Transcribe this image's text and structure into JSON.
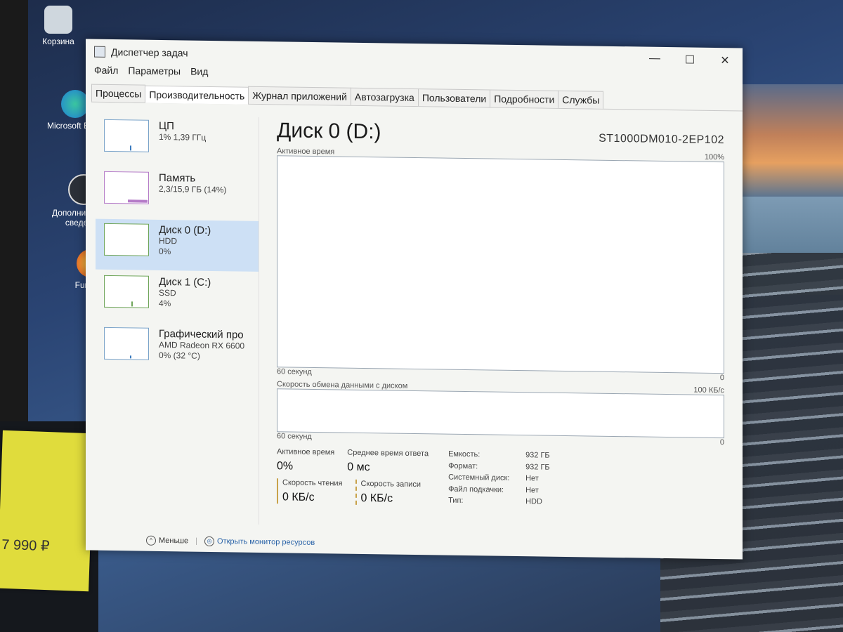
{
  "desktop": {
    "icons": [
      {
        "label": "Корзина",
        "icon": "recycle-bin-icon"
      },
      {
        "label": "Microsoft Edge",
        "icon": "edge-icon"
      },
      {
        "label": "Дополнительные сведения",
        "icon": "info-icon"
      },
      {
        "label": "FurMark",
        "icon": "furmark-icon"
      }
    ],
    "price": "7 990 ₽"
  },
  "window": {
    "title": "Диспетчер задач",
    "controls": {
      "minimize": "—",
      "maximize": "☐",
      "close": "✕"
    }
  },
  "menu": [
    "Файл",
    "Параметры",
    "Вид"
  ],
  "tabs": [
    {
      "label": "Процессы",
      "active": false
    },
    {
      "label": "Производительность",
      "active": true
    },
    {
      "label": "Журнал приложений",
      "active": false
    },
    {
      "label": "Автозагрузка",
      "active": false
    },
    {
      "label": "Пользователи",
      "active": false
    },
    {
      "label": "Подробности",
      "active": false
    },
    {
      "label": "Службы",
      "active": false
    }
  ],
  "sidebar": {
    "items": [
      {
        "name": "ЦП",
        "line1": "1% 1,39 ГГц",
        "line2": ""
      },
      {
        "name": "Память",
        "line1": "2,3/15,9 ГБ (14%)",
        "line2": ""
      },
      {
        "name": "Диск 0 (D:)",
        "line1": "HDD",
        "line2": "0%"
      },
      {
        "name": "Диск 1 (C:)",
        "line1": "SSD",
        "line2": "4%"
      },
      {
        "name": "Графический про",
        "line1": "AMD Radeon RX 6600",
        "line2": "0% (32 °C)"
      }
    ]
  },
  "main": {
    "title": "Диск 0 (D:)",
    "model": "ST1000DM010-2EP102",
    "graph1": {
      "label": "Активное время",
      "max": "100%",
      "xlabel": "60 секунд",
      "min": "0"
    },
    "graph2": {
      "label": "Скорость обмена данными с диском",
      "max": "100 КБ/с",
      "xlabel": "60 секунд",
      "min": "0"
    },
    "stats": {
      "active_time_label": "Активное время",
      "active_time_value": "0%",
      "avg_response_label": "Среднее время ответа",
      "avg_response_value": "0 мс",
      "read_label": "Скорость чтения",
      "read_value": "0 КБ/с",
      "write_label": "Скорость записи",
      "write_value": "0 КБ/с"
    },
    "props": [
      {
        "k": "Емкость:",
        "v": "932 ГБ"
      },
      {
        "k": "Формат:",
        "v": "932 ГБ"
      },
      {
        "k": "Системный диск:",
        "v": "Нет"
      },
      {
        "k": "Файл подкачки:",
        "v": "Нет"
      },
      {
        "k": "Тип:",
        "v": "HDD"
      }
    ]
  },
  "footer": {
    "less": "Меньше",
    "monitor": "Открыть монитор ресурсов"
  }
}
